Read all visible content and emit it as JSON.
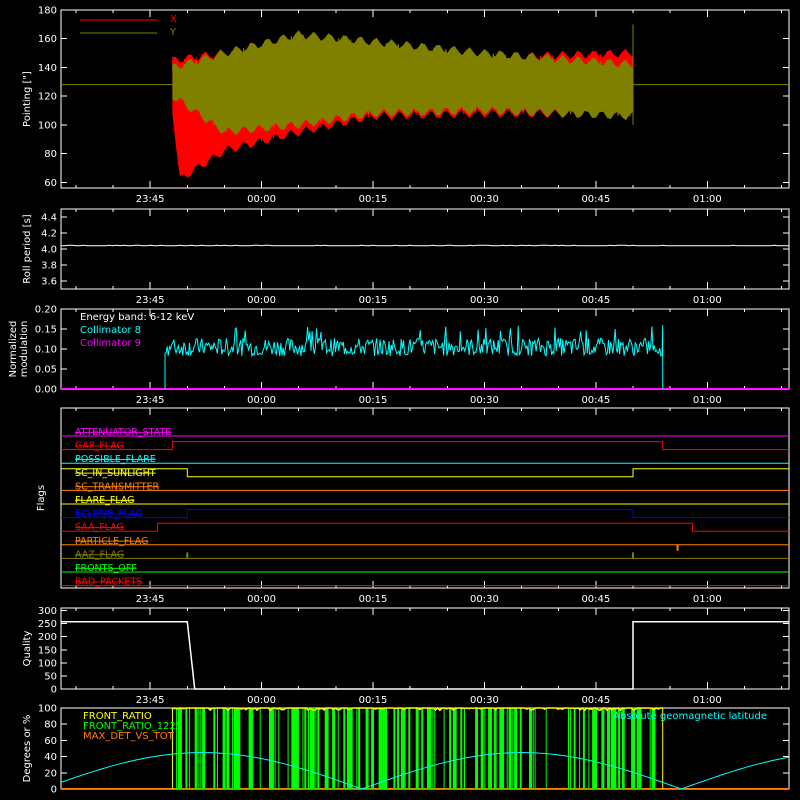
{
  "colors": {
    "background": "#000000",
    "axis": "#ffffff",
    "red": "#ff0000",
    "olive": "#808000",
    "cyan": "#00ffff",
    "magenta": "#ff00ff",
    "blue": "#0000ff",
    "yellow": "#ffff00",
    "green": "#00ff00",
    "orange": "#ff8000",
    "white": "#ffffff"
  },
  "chart_data": [
    {
      "id": "pointing",
      "type": "line",
      "ylabel": "Pointing [\"]",
      "ylim": [
        56,
        180
      ],
      "yticks": [
        60,
        80,
        100,
        120,
        140,
        160,
        180
      ],
      "x_axis": "time",
      "xlim": [
        "23:33",
        "01:11"
      ],
      "xticks": [
        "23:45",
        "00:00",
        "00:15",
        "00:30",
        "00:45",
        "01:00"
      ],
      "legend": "top-left",
      "reference_line": 128,
      "data_range": [
        "23:48",
        "00:50"
      ],
      "series": [
        {
          "name": "X",
          "color": "#ff0000",
          "upper": [
            [
              "23:48",
              145
            ],
            [
              "23:55",
              150
            ],
            [
              "00:05",
              150
            ],
            [
              "00:15",
              148
            ],
            [
              "00:30",
              147
            ],
            [
              "00:50",
              150
            ]
          ],
          "lower": [
            [
              "23:48",
              110
            ],
            [
              "23:49",
              62
            ],
            [
              "23:55",
              82
            ],
            [
              "00:05",
              95
            ],
            [
              "00:15",
              106
            ],
            [
              "00:30",
              108
            ],
            [
              "00:50",
              107
            ]
          ]
        },
        {
          "name": "Y",
          "color": "#808000",
          "upper": [
            [
              "23:48",
              140
            ],
            [
              "23:55",
              150
            ],
            [
              "00:05",
              163
            ],
            [
              "00:15",
              158
            ],
            [
              "00:30",
              150
            ],
            [
              "00:50",
              142
            ]
          ],
          "lower": [
            [
              "23:48",
              120
            ],
            [
              "23:55",
              95
            ],
            [
              "00:05",
              100
            ],
            [
              "00:15",
              108
            ],
            [
              "00:30",
              110
            ],
            [
              "00:50",
              106
            ]
          ]
        }
      ]
    },
    {
      "id": "roll",
      "type": "line",
      "ylabel": "Roll period [s]",
      "ylim": [
        3.5,
        4.5
      ],
      "yticks": [
        3.6,
        3.8,
        4.0,
        4.2,
        4.4
      ],
      "x_axis": "time",
      "xlim": [
        "23:33",
        "01:11"
      ],
      "xticks": [
        "23:45",
        "00:00",
        "00:15",
        "00:30",
        "00:45",
        "01:00"
      ],
      "series": [
        {
          "name": "",
          "color": "#ffffff",
          "value": 4.04
        }
      ]
    },
    {
      "id": "modulation",
      "type": "line",
      "ylabel": "Normalized modulation",
      "ylim": [
        0,
        0.2
      ],
      "yticks": [
        0.0,
        0.05,
        0.1,
        0.15,
        0.2
      ],
      "x_axis": "time",
      "xlim": [
        "23:33",
        "01:11"
      ],
      "xticks": [
        "23:45",
        "00:00",
        "00:15",
        "00:30",
        "00:45",
        "01:00"
      ],
      "legend": "top-left",
      "annotation": "Energy band: 6-12 keV",
      "series": [
        {
          "name": "Collimator 8",
          "color": "#00ffff",
          "mean": 0.105,
          "range": [
            "23:47",
            "00:54"
          ]
        },
        {
          "name": "Collimator 9",
          "color": "#ff00ff",
          "value": 0.0
        }
      ]
    },
    {
      "id": "flags",
      "type": "line",
      "ylabel": "Flags",
      "x_axis": "time",
      "xlim": [
        "23:33",
        "01:11"
      ],
      "xticks": [
        "23:45",
        "00:00",
        "00:15",
        "00:30",
        "00:45",
        "01:00"
      ],
      "series": [
        {
          "name": "ATTENUATOR_STATE",
          "color": "#ff00ff",
          "steps": [
            [
              "23:33",
              0
            ]
          ]
        },
        {
          "name": "GAP_FLAG",
          "color": "#ff0000",
          "steps": [
            [
              "23:33",
              1
            ],
            [
              "23:48",
              0
            ],
            [
              "00:54",
              1
            ]
          ]
        },
        {
          "name": "POSSIBLE_FLARE",
          "color": "#00ffff",
          "steps": [
            [
              "23:33",
              0
            ]
          ]
        },
        {
          "name": "SC_IN_SUNLIGHT",
          "color": "#ffff00",
          "steps": [
            [
              "23:33",
              0
            ],
            [
              "23:50",
              1
            ],
            [
              "00:50",
              0
            ]
          ]
        },
        {
          "name": "SC_TRANSMITTER",
          "color": "#ff8000",
          "steps": [
            [
              "23:33",
              0
            ]
          ]
        },
        {
          "name": "FLARE_FLAG",
          "color": "#ffff00",
          "steps": [
            [
              "23:33",
              0
            ]
          ]
        },
        {
          "name": "ECLIPSE_FLAG",
          "color": "#0000ff",
          "steps": [
            [
              "23:33",
              1
            ],
            [
              "23:50",
              0
            ],
            [
              "00:50",
              1
            ]
          ]
        },
        {
          "name": "SAA_FLAG",
          "color": "#ff0000",
          "steps": [
            [
              "23:33",
              1
            ],
            [
              "23:46",
              0
            ],
            [
              "00:58",
              1
            ]
          ]
        },
        {
          "name": "PARTICLE_FLAG",
          "color": "#ff8000",
          "steps": [
            [
              "23:33",
              0
            ]
          ],
          "spikes": [
            "00:56"
          ]
        },
        {
          "name": "AAZ_FLAG",
          "color": "#808000",
          "steps": [
            [
              "23:33",
              0
            ]
          ],
          "spikes": [
            "23:50",
            "00:50"
          ]
        },
        {
          "name": "FRONTS_OFF",
          "color": "#00ff00",
          "steps": [
            [
              "23:33",
              0
            ]
          ]
        },
        {
          "name": "BAD_PACKETS",
          "color": "#ff0000",
          "steps": [
            [
              "23:33",
              0
            ]
          ]
        }
      ]
    },
    {
      "id": "quality",
      "type": "line",
      "ylabel": "Quality",
      "ylim": [
        0,
        310
      ],
      "yticks": [
        0,
        50,
        100,
        150,
        200,
        250,
        300
      ],
      "x_axis": "time",
      "xlim": [
        "23:33",
        "01:11"
      ],
      "xticks": [
        "23:45",
        "00:00",
        "00:15",
        "00:30",
        "00:45",
        "01:00"
      ],
      "series": [
        {
          "name": "",
          "color": "#ffffff",
          "points": [
            [
              "23:33",
              257
            ],
            [
              "23:50",
              257
            ],
            [
              "23:51",
              0
            ],
            [
              "00:50",
              0
            ],
            [
              "00:50",
              257
            ],
            [
              "01:11",
              257
            ]
          ]
        }
      ]
    },
    {
      "id": "degrees",
      "type": "line",
      "ylabel": "Degrees or %",
      "ylim": [
        0,
        100
      ],
      "yticks": [
        0,
        20,
        40,
        60,
        80,
        100
      ],
      "x_axis": "time",
      "xlim": [
        "23:33",
        "01:11"
      ],
      "legend": "top-left",
      "series": [
        {
          "name": "FRONT_RATIO",
          "color": "#ffff00",
          "value": 100,
          "range": [
            "23:48",
            "00:54"
          ]
        },
        {
          "name": "FRONT_RATIO_1225",
          "color": "#00ff00",
          "range": [
            "23:48",
            "00:54"
          ]
        },
        {
          "name": "MAX_DET_VS_TOT",
          "color": "#ff8000",
          "value": 0
        },
        {
          "name": "Absolute geomagnetic latitude",
          "color": "#00ffff",
          "points": [
            [
              "23:33",
              0
            ],
            [
              "23:50",
              45
            ],
            [
              "00:09",
              0
            ],
            [
              "00:32",
              45
            ],
            [
              "00:53",
              0
            ],
            [
              "01:11",
              22
            ]
          ]
        }
      ]
    }
  ]
}
